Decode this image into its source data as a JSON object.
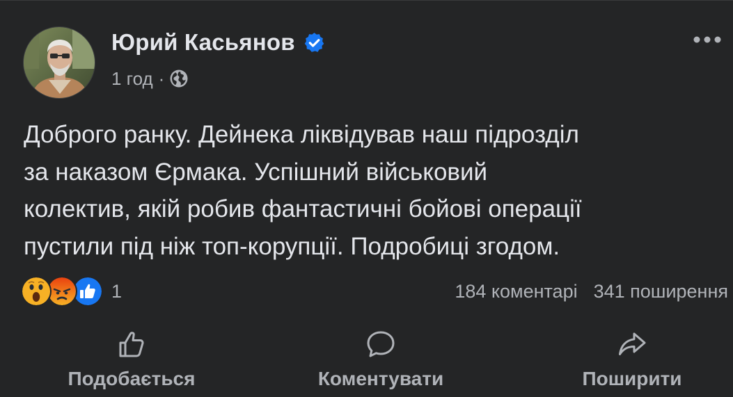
{
  "post": {
    "author_name": "Юрий Касьянов",
    "time": "1 год",
    "separator": "·",
    "text": "Доброго ранку. Дейнека ліквідував наш підрозділ\nза наказом Єрмака. Успішний військовий\nколектив, якій робив фантастичні бойові операції\nпустили під ніж топ-корупції. Подробиці згодом.",
    "verified": true,
    "audience_icon": "globe-icon",
    "more_icon": "more-options-icon"
  },
  "reactions": {
    "icons": [
      "wow-icon",
      "angry-icon",
      "like-icon"
    ],
    "count": "1"
  },
  "stats": {
    "comments": "184 коментарі",
    "shares": "341 поширення"
  },
  "actions": {
    "like_label": "Подобається",
    "comment_label": "Коментувати",
    "share_label": "Поширити"
  },
  "colors": {
    "background": "#242526",
    "text_primary": "#e4e6eb",
    "text_secondary": "#b0b3b8",
    "verified_blue": "#1877f2",
    "reaction_yellow": "#f7b125",
    "reaction_angry": "#e9710f"
  }
}
